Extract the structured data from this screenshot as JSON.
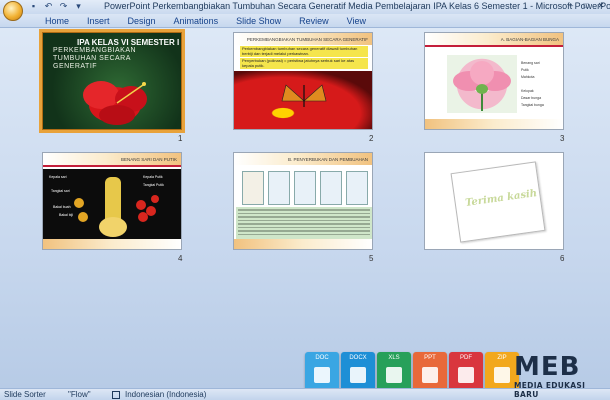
{
  "window": {
    "title": "PowerPoint Perkembangbiakan Tumbuhan Secara Generatif Media Pembelajaran IPA Kelas 6 Semester 1 - Microsoft PowerPoint",
    "controls": [
      "–",
      "□",
      "✕"
    ]
  },
  "ribbon": {
    "tabs": [
      "Home",
      "Insert",
      "Design",
      "Animations",
      "Slide Show",
      "Review",
      "View"
    ]
  },
  "slides": [
    {
      "number": "1",
      "heading": "IPA KELAS VI SEMESTER I",
      "subtitle": "PERKEMBANGBIAKAN TUMBUHAN SECARA GENERATIF",
      "selected": true
    },
    {
      "number": "2",
      "title": "PERKEMBANGBIAKAN TUMBUHAN SECARA GENERATIF",
      "bullet1": "Perkembangbiakan tumbuhan secara generatif diawali tumbuhan berbiji dan terjadi melalui perkawinan.",
      "bullet2": "Penyerbukan (polinasi) = peristiwa jatuhnya serbuk sari ke atas kepala putik."
    },
    {
      "number": "3",
      "title": "A. BAGIAN-BAGIAN BUNGA",
      "labels": [
        "Benang sari",
        "Putik",
        "Mahkota",
        "Kelopak",
        "Dasar bunga",
        "Tangkai bunga"
      ]
    },
    {
      "number": "4",
      "title": "BENANG SARI DAN PUTIK",
      "labels": [
        "Kepala sari",
        "Kepala Putik",
        "Tangkai sari",
        "Tangkai Putik",
        "Bakal buah",
        "Bakal biji"
      ]
    },
    {
      "number": "5",
      "title": "B. PENYERBUKAN DAN PEMBUAHAN"
    },
    {
      "number": "6",
      "text": "Terima kasih"
    }
  ],
  "status": {
    "view": "Slide Sorter",
    "theme": "\"Flow\"",
    "language": "Indonesian (Indonesia)"
  },
  "watermark": {
    "file_icons": [
      {
        "label": "DOC",
        "color": "#3aa6e3"
      },
      {
        "label": "DOCX",
        "color": "#1e8fd6"
      },
      {
        "label": "XLS",
        "color": "#27a05a"
      },
      {
        "label": "PPT",
        "color": "#e8693a"
      },
      {
        "label": "PDF",
        "color": "#d9363e"
      },
      {
        "label": "ZIP",
        "color": "#f2a81d"
      }
    ],
    "brand": "MEB",
    "tagline": "MEDIA EDUKASI BARU"
  }
}
